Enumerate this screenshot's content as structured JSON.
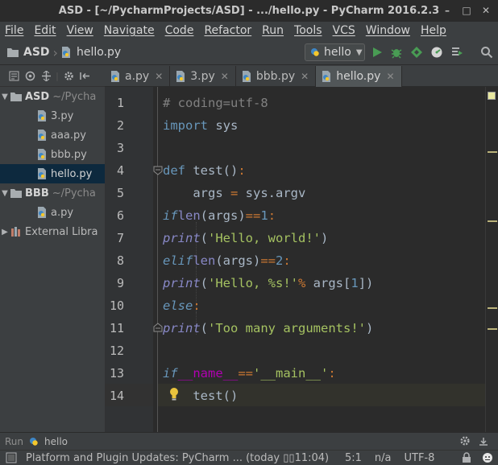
{
  "window": {
    "title": "ASD - [~/PycharmProjects/ASD] - .../hello.py - PyCharm 2016.2.3"
  },
  "menu": [
    "File",
    "Edit",
    "View",
    "Navigate",
    "Code",
    "Refactor",
    "Run",
    "Tools",
    "VCS",
    "Window",
    "Help"
  ],
  "breadcrumbs": [
    "ASD",
    "hello.py"
  ],
  "run_config": "hello",
  "icons": {
    "run": "run-icon",
    "debug": "debug-icon",
    "coverage": "coverage-icon",
    "profile": "profile-icon",
    "concurrency": "concurrency-icon",
    "search": "search-icon"
  },
  "project_tree": [
    {
      "type": "folder",
      "name": "ASD",
      "hint": "~/Pycha"
    },
    {
      "type": "file",
      "name": "3.py"
    },
    {
      "type": "file",
      "name": "aaa.py"
    },
    {
      "type": "file",
      "name": "bbb.py"
    },
    {
      "type": "file",
      "name": "hello.py",
      "selected": true
    },
    {
      "type": "folder",
      "name": "BBB",
      "hint": "~/Pycha"
    },
    {
      "type": "file",
      "name": "a.py"
    },
    {
      "type": "lib",
      "name": "External Libra"
    }
  ],
  "tabs": [
    {
      "label": "a.py",
      "active": false
    },
    {
      "label": "3.py",
      "active": false
    },
    {
      "label": "bbb.py",
      "active": false
    },
    {
      "label": "hello.py",
      "active": true
    }
  ],
  "editor": {
    "line_numbers": [
      "1",
      "2",
      "3",
      "4",
      "5",
      "6",
      "7",
      "8",
      "9",
      "10",
      "11",
      "12",
      "13",
      "14"
    ],
    "code": [
      "# coding=utf-8",
      "import sys",
      "",
      "def test():",
      "    args = sys.argv",
      "    if len(args)==1:",
      "            print('Hello, world!')",
      "    elif len(args)==2:",
      "        print('Hello, %s!' % args[1])",
      "    else:",
      "        print('Too many arguments!')",
      "",
      "if __name__=='__main__':",
      "    test()"
    ],
    "current_line": "14"
  },
  "run_panel": {
    "label": "Run",
    "config": "hello"
  },
  "status": {
    "message": "Platform and Plugin Updates: PyCharm ... (today ▯▯11:04)",
    "position": "5:1",
    "line_sep": "n/a",
    "encoding": "UTF-8"
  },
  "colors": {
    "keyword": "#cc7832",
    "string": "#a5c261",
    "number": "#6897bb",
    "comment": "#808080",
    "builtin": "#8888c6",
    "dunder": "#b200b2",
    "selection": "#0d293e"
  }
}
